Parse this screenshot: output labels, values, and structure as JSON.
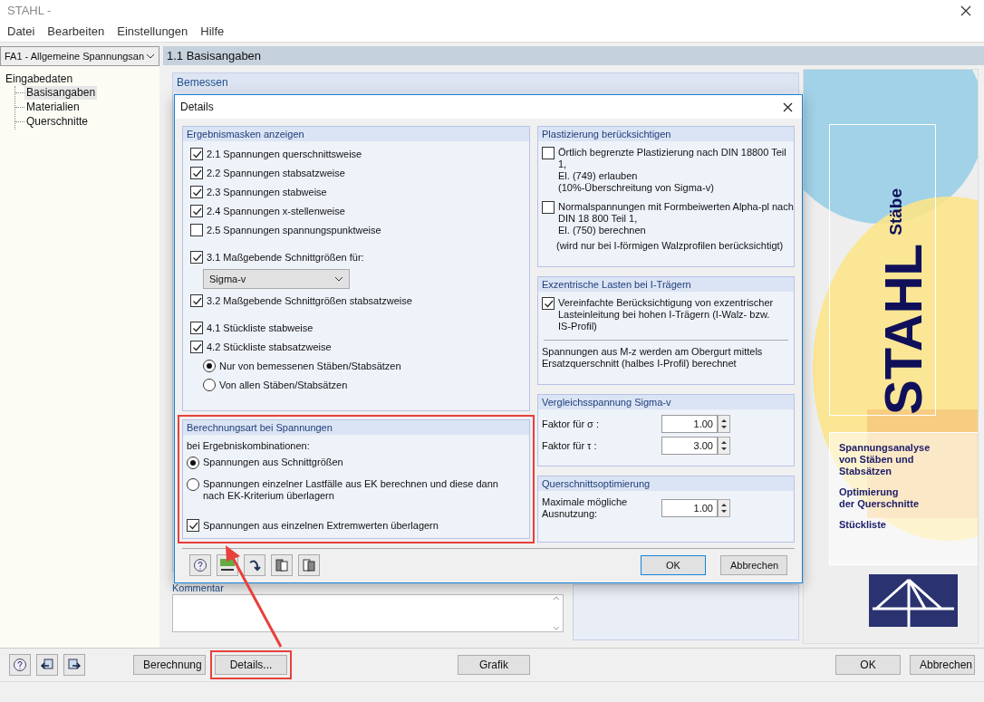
{
  "window": {
    "title": "STAHL -"
  },
  "menu": [
    "Datei",
    "Bearbeiten",
    "Einstellungen",
    "Hilfe"
  ],
  "sidebar": {
    "case_select": "FA1 - Allgemeine Spannungsan",
    "tree": {
      "label": "Eingabedaten",
      "children": [
        {
          "label": "Basisangaben",
          "selected": true
        },
        {
          "label": "Materialien",
          "selected": false
        },
        {
          "label": "Querschnitte",
          "selected": false
        }
      ]
    }
  },
  "page": {
    "title": "1.1 Basisangaben",
    "sections": [
      "Bemessen",
      "Kommentar"
    ]
  },
  "banner": {
    "title": "STAHL",
    "subtitle": "Stäbe",
    "features": [
      "Spannungsanalyse\nvon Stäben und\nStabsätzen",
      "Optimierung\nder Querschnitte",
      "Stückliste"
    ]
  },
  "dialog": {
    "title": "Details",
    "result_masks": {
      "title": "Ergebnismasken anzeigen",
      "groups": [
        [
          {
            "kind": "checkbox",
            "label": "2.1 Spannungen querschnittsweise",
            "checked": true
          },
          {
            "kind": "checkbox",
            "label": "2.2 Spannungen stabsatzweise",
            "checked": true
          },
          {
            "kind": "checkbox",
            "label": "2.3 Spannungen stabweise",
            "checked": true
          },
          {
            "kind": "checkbox",
            "label": "2.4 Spannungen x-stellenweise",
            "checked": true
          },
          {
            "kind": "checkbox",
            "label": "2.5 Spannungen spannungspunktweise",
            "checked": false
          }
        ],
        [
          {
            "kind": "checkbox",
            "label": "3.1 Maßgebende Schnittgrößen für:",
            "checked": true
          },
          {
            "kind": "select",
            "value": "Sigma-v"
          },
          {
            "kind": "checkbox",
            "label": "3.2 Maßgebende Schnittgrößen stabsatzweise",
            "checked": true
          }
        ],
        [
          {
            "kind": "checkbox",
            "label": "4.1 Stückliste stabweise",
            "checked": true
          },
          {
            "kind": "checkbox",
            "label": "4.2 Stückliste stabsatzweise",
            "checked": true
          },
          {
            "kind": "radio",
            "label": "Nur von bemessenen Stäben/Stabsätzen",
            "selected": true
          },
          {
            "kind": "radio",
            "label": "Von allen Stäben/Stabsätzen",
            "selected": false
          }
        ]
      ]
    },
    "calc_method": {
      "title": "Berechnungsart bei Spannungen",
      "highlighted": true,
      "intro": "bei Ergebniskombinationen:",
      "options": [
        {
          "label": "Spannungen aus Schnittgrößen",
          "selected": true
        },
        {
          "label": "Spannungen einzelner Lastfälle aus EK berechnen und diese dann\nnach EK-Kriterium überlagern",
          "selected": false
        }
      ],
      "extreme": {
        "label": "Spannungen aus einzelnen Extremwerten überlagern",
        "checked": true
      }
    },
    "plasticity": {
      "title": "Plastizierung berücksichtigen",
      "options": [
        {
          "label": "Örtlich begrenzte Plastizierung nach DIN 18800 Teil 1,\nEl. (749) erlauben\n(10%-Überschreitung von Sigma-v)",
          "checked": false
        },
        {
          "label": "Normalspannungen mit Formbeiwerten Alpha-pl nach\nDIN 18 800 Teil 1,\nEl. (750) berechnen",
          "checked": false
        }
      ],
      "note": "(wird nur bei I-förmigen Walzprofilen berücksichtigt)"
    },
    "eccentric": {
      "title": "Exzentrische Lasten bei I-Trägern",
      "option": {
        "label": "Vereinfachte Berücksichtigung von exzentrischer\nLasteinleitung bei hohen I-Trägern (I-Walz- bzw.\nIS-Profil)",
        "checked": true
      },
      "note": "Spannungen aus M-z werden am Obergurt mittels\nErsatzquerschnitt (halbes I-Profil) berechnet"
    },
    "equivalent_stress": {
      "title": "Vergleichsspannung Sigma-v",
      "fields": [
        {
          "label": "Faktor für σ :",
          "value": "1.00"
        },
        {
          "label": "Faktor für τ :",
          "value": "3.00"
        }
      ]
    },
    "optimization": {
      "title": "Querschnittsoptimierung",
      "fields": [
        {
          "label": "Maximale mögliche\nAusnutzung:",
          "value": "1.00"
        }
      ]
    },
    "buttons": [
      "OK",
      "Abbrechen"
    ]
  },
  "bottom_bar": {
    "buttons": [
      {
        "label": "Berechnung",
        "highlighted": false
      },
      {
        "label": "Details...",
        "highlighted": true
      },
      {
        "label": "Grafik",
        "highlighted": false
      }
    ],
    "dialog_buttons": [
      "OK",
      "Abbrechen"
    ]
  }
}
